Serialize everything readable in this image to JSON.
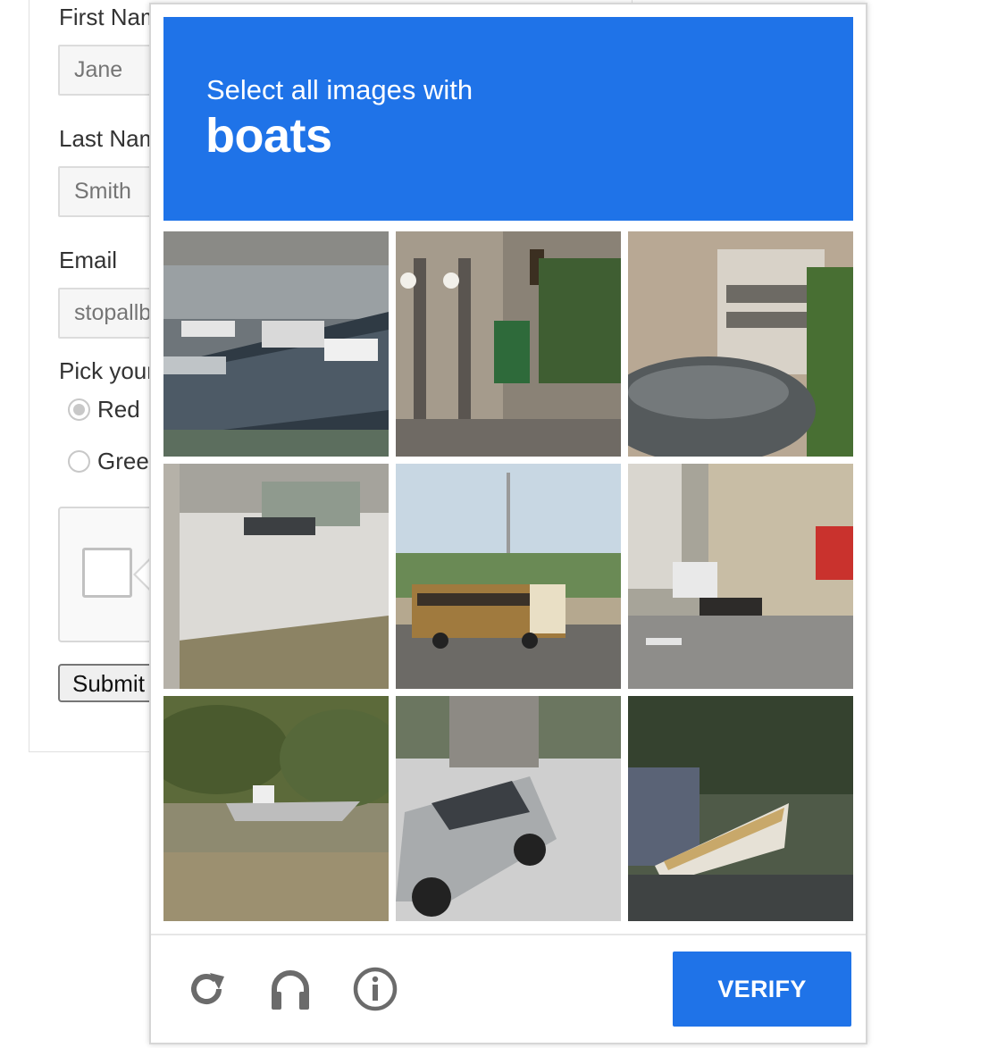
{
  "form": {
    "first_name": {
      "label": "First Name",
      "value": "Jane"
    },
    "last_name": {
      "label": "Last Name",
      "value": "Smith"
    },
    "email": {
      "label": "Email",
      "value": "stopallbots@gmail.com"
    },
    "color": {
      "label": "Pick your favorite color:",
      "options": [
        {
          "label": "Red",
          "checked": true
        },
        {
          "label": "Green",
          "checked": false
        }
      ]
    },
    "submit_label": "Submit"
  },
  "challenge": {
    "instruction": "Select all images with",
    "target": "boats",
    "tiles": [
      {
        "name": "harbor-marina"
      },
      {
        "name": "street-lamps-building"
      },
      {
        "name": "garage-car"
      },
      {
        "name": "snowy-field-houses"
      },
      {
        "name": "school-bus-road"
      },
      {
        "name": "city-street-motorbikes"
      },
      {
        "name": "boat-in-bushes"
      },
      {
        "name": "silver-suv-street"
      },
      {
        "name": "boat-on-trailer"
      }
    ],
    "icons": [
      "reload-icon",
      "audio-icon",
      "info-icon"
    ],
    "verify_label": "VERIFY"
  },
  "colors": {
    "accent": "#1f73e8"
  }
}
